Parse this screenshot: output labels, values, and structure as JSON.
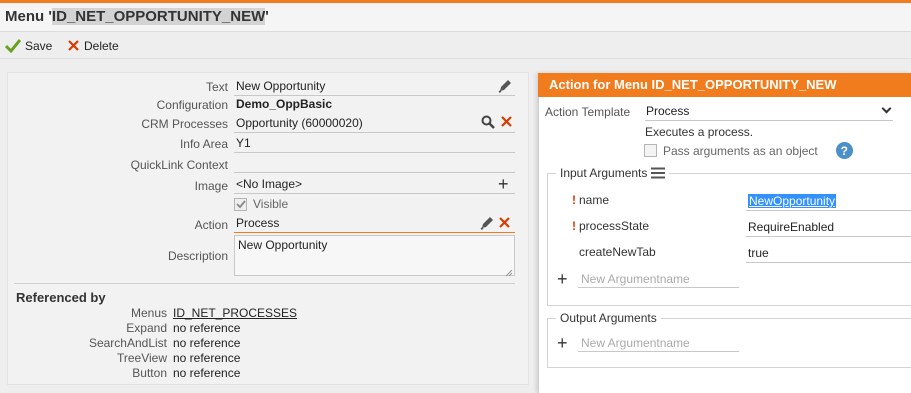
{
  "header": {
    "title_prefix": "Menu '",
    "title_id": "ID_NET_OPPORTUNITY_NEW",
    "title_suffix": "'"
  },
  "toolbar": {
    "save_label": "Save",
    "delete_label": "Delete"
  },
  "form": {
    "text_label": "Text",
    "text_value": "New Opportunity",
    "configuration_label": "Configuration",
    "configuration_value": "Demo_OppBasic",
    "crm_processes_label": "CRM Processes",
    "crm_processes_value": "Opportunity (60000020)",
    "info_area_label": "Info Area",
    "info_area_value": "Y1",
    "quicklink_label": "QuickLink Context",
    "quicklink_value": "",
    "image_label": "Image",
    "image_value": "<No Image>",
    "visible_label": "Visible",
    "visible_checked": true,
    "action_label": "Action",
    "action_value": "Process",
    "description_label": "Description",
    "description_value": "New Opportunity"
  },
  "referenced": {
    "heading": "Referenced by",
    "rows": [
      {
        "label": "Menus",
        "value": "ID_NET_PROCESSES",
        "link": true
      },
      {
        "label": "Expand",
        "value": "no reference",
        "link": false
      },
      {
        "label": "SearchAndList",
        "value": "no reference",
        "link": false
      },
      {
        "label": "TreeView",
        "value": "no reference",
        "link": false
      },
      {
        "label": "Button",
        "value": "no reference",
        "link": false
      }
    ]
  },
  "action_panel": {
    "header": "Action for Menu ID_NET_OPPORTUNITY_NEW",
    "template_label": "Action Template",
    "template_value": "Process",
    "template_description": "Executes a process.",
    "pass_args_label": "Pass arguments as an object",
    "pass_args_checked": false,
    "help_glyph": "?",
    "input_args_legend": "Input Arguments",
    "input_args": [
      {
        "name": "name",
        "required": true,
        "value": "NewOpportunity"
      },
      {
        "name": "processState",
        "required": true,
        "value": "RequireEnabled"
      },
      {
        "name": "createNewTab",
        "required": false,
        "value": "true"
      }
    ],
    "new_arg_placeholder": "New Argumentname",
    "output_args_legend": "Output Arguments",
    "output_new_arg_placeholder": "New Argumentname"
  },
  "colors": {
    "accent": "#f07c1d",
    "save_check": "#6aa121",
    "delete_x": "#d83b01",
    "help": "#4b90c6"
  },
  "icons": {
    "save": "checkmark-icon",
    "delete": "x-icon",
    "edit": "pencil-icon",
    "search": "magnifier-icon",
    "clear": "x-icon",
    "add": "plus-icon",
    "list": "list-icon",
    "help": "question-icon"
  }
}
